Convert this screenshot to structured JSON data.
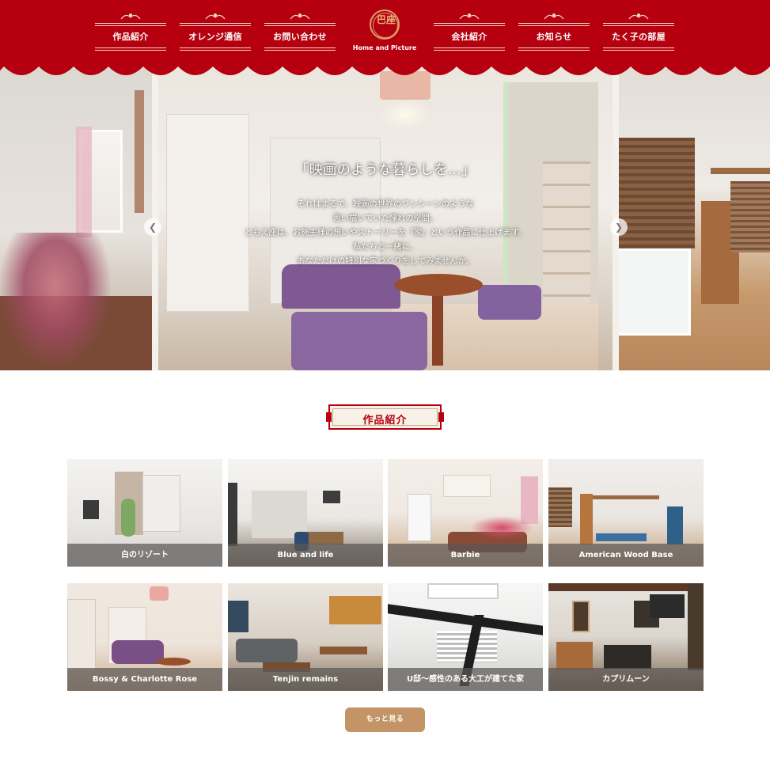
{
  "header": {
    "nav_left": [
      {
        "label": "作品紹介"
      },
      {
        "label": "オレンジ通信"
      },
      {
        "label": "お問い合わせ"
      }
    ],
    "nav_right": [
      {
        "label": "会社紹介"
      },
      {
        "label": "お知らせ"
      },
      {
        "label": "たく子の部屋"
      }
    ],
    "logo_kanji": "巴座",
    "logo_subtitle": "Home and Picture",
    "brand_color": "#b6000f"
  },
  "hero": {
    "title": "「映画のような暮らしを…」",
    "lines": [
      "それはまるで、映画の世界のワンシーンのような",
      "思い描いていた憧れの空間。",
      "ともえ座は、お施主様の想いやストーリーを『家』という作品に仕上げます。",
      "私たちと一緒に、",
      "あなただけの特別な家づくりをしてみませんか。"
    ],
    "prev_icon": "chevron-left-icon",
    "next_icon": "chevron-right-icon"
  },
  "works": {
    "section_title": "作品紹介",
    "items": [
      {
        "caption": "白のリゾート"
      },
      {
        "caption": "Blue and life"
      },
      {
        "caption": "Barbie"
      },
      {
        "caption": "American Wood Base"
      },
      {
        "caption": "Bossy & Charlotte Rose"
      },
      {
        "caption": "Tenjin remains"
      },
      {
        "caption": "U邸～感性のある大工が建てた家"
      },
      {
        "caption": "カプリムーン"
      }
    ],
    "more_label": "もっと見る",
    "more_color": "#c49467"
  }
}
